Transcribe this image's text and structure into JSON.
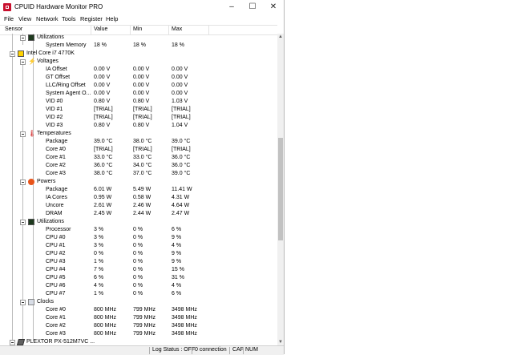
{
  "window": {
    "title": "CPUID Hardware Monitor PRO",
    "controls": {
      "minimize": "–",
      "maximize": "☐",
      "close": "✕"
    }
  },
  "menu": [
    "File",
    "View",
    "Network",
    "Tools",
    "Register",
    "Help"
  ],
  "columns": {
    "sensor": "Sensor",
    "value": "Value",
    "min": "Min",
    "max": "Max"
  },
  "rows": [
    {
      "level": 2,
      "kind": "group",
      "icon": "utilizations-icon",
      "label": "Utilizations",
      "value": "",
      "min": "",
      "max": ""
    },
    {
      "level": 3,
      "kind": "leaf",
      "label": "System Memory",
      "value": "18 %",
      "min": "18 %",
      "max": "18 %"
    },
    {
      "level": 1,
      "kind": "device",
      "icon": "cpu-chip-icon",
      "label": "Intel Core i7 4770K",
      "value": "",
      "min": "",
      "max": ""
    },
    {
      "level": 2,
      "kind": "group",
      "icon": "voltage-icon",
      "label": "Voltages",
      "value": "",
      "min": "",
      "max": ""
    },
    {
      "level": 3,
      "kind": "leaf",
      "label": "IA Offset",
      "value": "0.00 V",
      "min": "0.00 V",
      "max": "0.00 V"
    },
    {
      "level": 3,
      "kind": "leaf",
      "label": "GT Offset",
      "value": "0.00 V",
      "min": "0.00 V",
      "max": "0.00 V"
    },
    {
      "level": 3,
      "kind": "leaf",
      "label": "LLC/Ring Offset",
      "value": "0.00 V",
      "min": "0.00 V",
      "max": "0.00 V"
    },
    {
      "level": 3,
      "kind": "leaf",
      "label": "System Agent O...",
      "value": "0.00 V",
      "min": "0.00 V",
      "max": "0.00 V"
    },
    {
      "level": 3,
      "kind": "leaf",
      "label": "VID #0",
      "value": "0.80 V",
      "min": "0.80 V",
      "max": "1.03 V"
    },
    {
      "level": 3,
      "kind": "leaf",
      "label": "VID #1",
      "value": "[TRIAL]",
      "min": "[TRIAL]",
      "max": "[TRIAL]"
    },
    {
      "level": 3,
      "kind": "leaf",
      "label": "VID #2",
      "value": "[TRIAL]",
      "min": "[TRIAL]",
      "max": "[TRIAL]"
    },
    {
      "level": 3,
      "kind": "leaf",
      "label": "VID #3",
      "value": "0.80 V",
      "min": "0.80 V",
      "max": "1.04 V"
    },
    {
      "level": 2,
      "kind": "group",
      "icon": "thermometer-icon",
      "label": "Temperatures",
      "value": "",
      "min": "",
      "max": ""
    },
    {
      "level": 3,
      "kind": "leaf",
      "label": "Package",
      "value": "39.0 °C",
      "min": "38.0 °C",
      "max": "39.0 °C"
    },
    {
      "level": 3,
      "kind": "leaf",
      "label": "Core #0",
      "value": "[TRIAL]",
      "min": "[TRIAL]",
      "max": "[TRIAL]"
    },
    {
      "level": 3,
      "kind": "leaf",
      "label": "Core #1",
      "value": "33.0 °C",
      "min": "33.0 °C",
      "max": "36.0 °C"
    },
    {
      "level": 3,
      "kind": "leaf",
      "label": "Core #2",
      "value": "36.0 °C",
      "min": "34.0 °C",
      "max": "36.0 °C"
    },
    {
      "level": 3,
      "kind": "leaf",
      "label": "Core #3",
      "value": "38.0 °C",
      "min": "37.0 °C",
      "max": "39.0 °C"
    },
    {
      "level": 2,
      "kind": "group",
      "icon": "power-icon",
      "label": "Powers",
      "value": "",
      "min": "",
      "max": ""
    },
    {
      "level": 3,
      "kind": "leaf",
      "label": "Package",
      "value": "6.01 W",
      "min": "5.49 W",
      "max": "11.41 W"
    },
    {
      "level": 3,
      "kind": "leaf",
      "label": "IA Cores",
      "value": "0.95 W",
      "min": "0.58 W",
      "max": "4.31 W"
    },
    {
      "level": 3,
      "kind": "leaf",
      "label": "Uncore",
      "value": "2.61 W",
      "min": "2.46 W",
      "max": "4.64 W"
    },
    {
      "level": 3,
      "kind": "leaf",
      "label": "DRAM",
      "value": "2.45 W",
      "min": "2.44 W",
      "max": "2.47 W"
    },
    {
      "level": 2,
      "kind": "group",
      "icon": "utilizations-icon",
      "label": "Utilizations",
      "value": "",
      "min": "",
      "max": ""
    },
    {
      "level": 3,
      "kind": "leaf",
      "label": "Processor",
      "value": "3 %",
      "min": "0 %",
      "max": "6 %"
    },
    {
      "level": 3,
      "kind": "leaf",
      "label": "CPU #0",
      "value": "3 %",
      "min": "0 %",
      "max": "9 %"
    },
    {
      "level": 3,
      "kind": "leaf",
      "label": "CPU #1",
      "value": "3 %",
      "min": "0 %",
      "max": "4 %"
    },
    {
      "level": 3,
      "kind": "leaf",
      "label": "CPU #2",
      "value": "0 %",
      "min": "0 %",
      "max": "9 %"
    },
    {
      "level": 3,
      "kind": "leaf",
      "label": "CPU #3",
      "value": "1 %",
      "min": "0 %",
      "max": "9 %"
    },
    {
      "level": 3,
      "kind": "leaf",
      "label": "CPU #4",
      "value": "7 %",
      "min": "0 %",
      "max": "15 %"
    },
    {
      "level": 3,
      "kind": "leaf",
      "label": "CPU #5",
      "value": "6 %",
      "min": "0 %",
      "max": "31 %"
    },
    {
      "level": 3,
      "kind": "leaf",
      "label": "CPU #6",
      "value": "4 %",
      "min": "0 %",
      "max": "4 %"
    },
    {
      "level": 3,
      "kind": "leaf",
      "label": "CPU #7",
      "value": "1 %",
      "min": "0 %",
      "max": "6 %"
    },
    {
      "level": 2,
      "kind": "group",
      "icon": "clock-icon",
      "label": "Clocks",
      "value": "",
      "min": "",
      "max": ""
    },
    {
      "level": 3,
      "kind": "leaf",
      "label": "Core #0",
      "value": "800 MHz",
      "min": "799 MHz",
      "max": "3498 MHz"
    },
    {
      "level": 3,
      "kind": "leaf",
      "label": "Core #1",
      "value": "800 MHz",
      "min": "799 MHz",
      "max": "3498 MHz"
    },
    {
      "level": 3,
      "kind": "leaf",
      "label": "Core #2",
      "value": "800 MHz",
      "min": "799 MHz",
      "max": "3498 MHz"
    },
    {
      "level": 3,
      "kind": "leaf",
      "label": "Core #3",
      "value": "800 MHz",
      "min": "799 MHz",
      "max": "3498 MHz"
    },
    {
      "level": 1,
      "kind": "device",
      "icon": "hard-drive-icon",
      "label": "PLEXTOR PX-512M7VC ...",
      "value": "",
      "min": "",
      "max": ""
    }
  ],
  "status": {
    "log": "Log Status : OFF",
    "connection": "0 connection",
    "cap": "CAP",
    "num": "NUM"
  }
}
